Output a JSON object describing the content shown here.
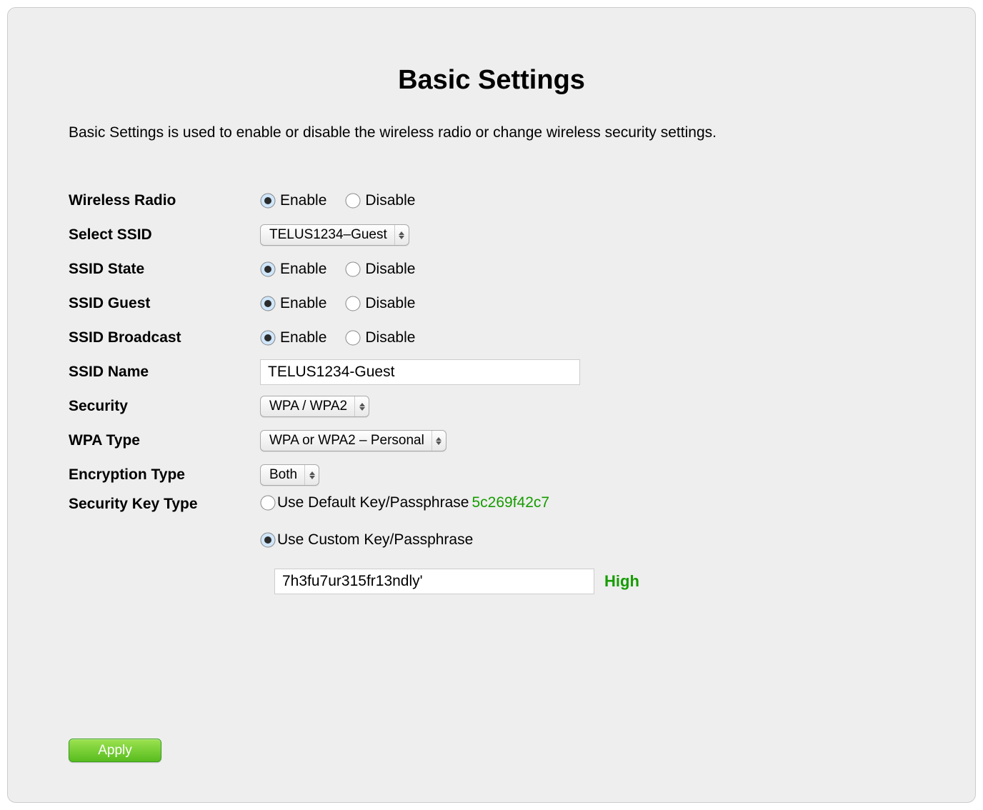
{
  "title": "Basic Settings",
  "description": "Basic Settings is used to enable or disable the wireless radio or change wireless security settings.",
  "labels": {
    "wireless_radio": "Wireless Radio",
    "select_ssid": "Select SSID",
    "ssid_state": "SSID State",
    "ssid_guest": "SSID Guest",
    "ssid_broadcast": "SSID Broadcast",
    "ssid_name": "SSID Name",
    "security": "Security",
    "wpa_type": "WPA Type",
    "encryption_type": "Encryption Type",
    "security_key_type": "Security Key Type"
  },
  "options": {
    "enable": "Enable",
    "disable": "Disable",
    "use_default": "Use Default Key/Passphrase",
    "use_custom": "Use Custom Key/Passphrase"
  },
  "values": {
    "wireless_radio": "enable",
    "select_ssid": "TELUS1234–Guest",
    "ssid_state": "enable",
    "ssid_guest": "enable",
    "ssid_broadcast": "enable",
    "ssid_name": "TELUS1234-Guest",
    "security": "WPA / WPA2",
    "wpa_type": "WPA or WPA2 – Personal",
    "encryption_type": "Both",
    "security_key_type": "custom",
    "default_key": "5c269f42c7",
    "custom_key": "7h3fu7ur315fr13ndly'",
    "strength": "High"
  },
  "buttons": {
    "apply": "Apply"
  }
}
